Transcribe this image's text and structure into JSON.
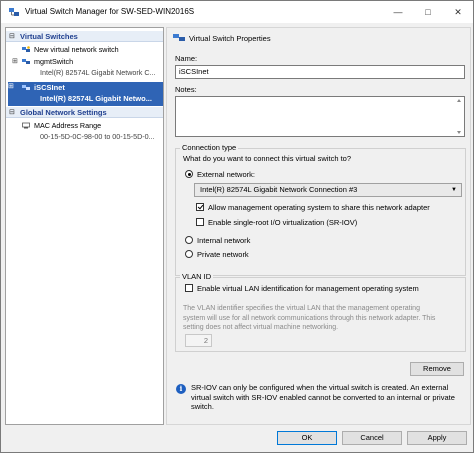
{
  "window": {
    "title": "Virtual Switch Manager for SW-SED-WIN2016S",
    "minimize_glyph": "—",
    "maximize_glyph": "□",
    "close_glyph": "✕"
  },
  "tree": {
    "virtual_switches_header": "Virtual Switches",
    "new_switch": "New virtual network switch",
    "mgmt_switch": "mgmtSwitch",
    "mgmt_adapter": "Intel(R) 82574L Gigabit Network C...",
    "iscsi_switch": "iSCSInet",
    "iscsi_adapter": "Intel(R) 82574L Gigabit Netwo...",
    "global_header": "Global Network Settings",
    "mac_range": "MAC Address Range",
    "mac_range_value": "00-15-5D-0C-98-00 to 00-15-5D-0...",
    "expand_glyph": "➖",
    "plus_glyph": "⊞"
  },
  "props": {
    "section_title": "Virtual Switch Properties",
    "name_label": "Name:",
    "name_value": "iSCSInet",
    "notes_label": "Notes:",
    "notes_value": "",
    "connection_type_label": "Connection type",
    "connection_question": "What do you want to connect this virtual switch to?",
    "external_label": "External network:",
    "external_selected": "Intel(R) 82574L Gigabit Network Connection #3",
    "allow_mgmt_label": "Allow management operating system to share this network adapter",
    "allow_mgmt_checked": true,
    "sriov_label": "Enable single-root I/O virtualization (SR-IOV)",
    "sriov_checked": false,
    "internal_label": "Internal network",
    "private_label": "Private network",
    "connection_selected": "external",
    "vlan_label": "VLAN ID",
    "vlan_enable_label": "Enable virtual LAN identification for management operating system",
    "vlan_enabled": false,
    "vlan_desc_1": "The VLAN identifier specifies the virtual LAN that the management operating",
    "vlan_desc_2": "system will use for all network communications through this network adapter. This",
    "vlan_desc_3": "setting does not affect virtual machine networking.",
    "vlan_value": "2",
    "remove_label": "Remove",
    "info_1": "SR-IOV can only be configured when the virtual switch is created. An external",
    "info_2": "virtual switch with SR-IOV enabled cannot be converted to an internal or private",
    "info_3": "switch.",
    "info_glyph": "i"
  },
  "footer": {
    "ok_label": "OK",
    "cancel_label": "Cancel",
    "apply_label": "Apply"
  },
  "colors": {
    "selection": "#2f64b5",
    "header_text": "#1f3f8f",
    "info_blue": "#1e5fc0"
  }
}
